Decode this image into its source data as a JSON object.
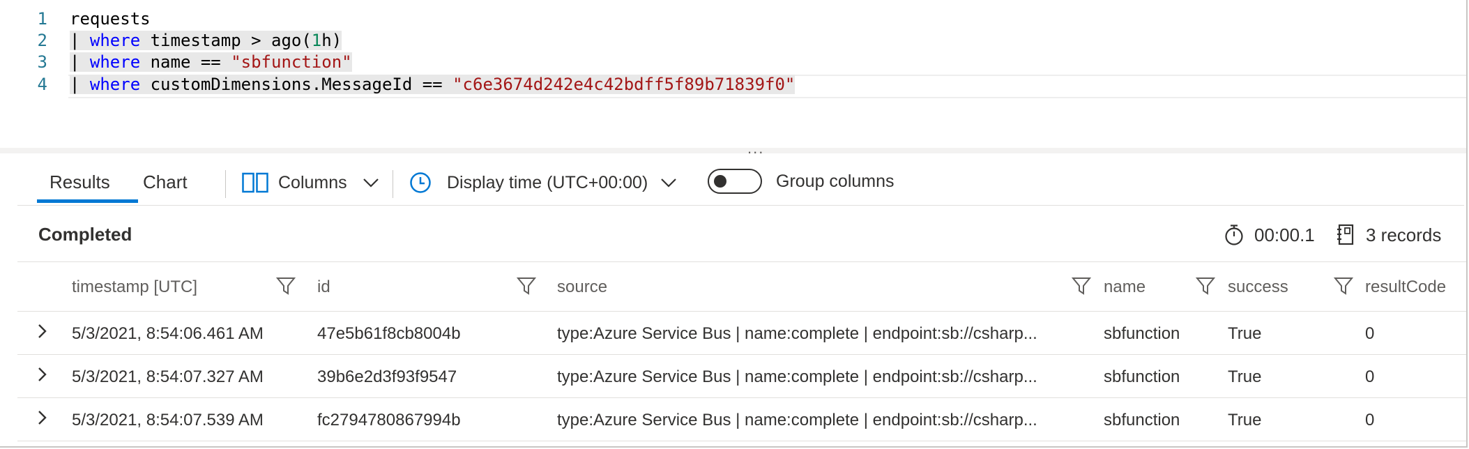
{
  "editor": {
    "lines": [
      {
        "num": "1",
        "parts": [
          {
            "t": "requests",
            "c": ""
          }
        ]
      },
      {
        "num": "2",
        "parts": [
          {
            "t": "| ",
            "c": ""
          },
          {
            "t": "where",
            "c": "kw"
          },
          {
            "t": " timestamp > ago(",
            "c": ""
          },
          {
            "t": "1",
            "c": "num"
          },
          {
            "t": "h)",
            "c": ""
          }
        ]
      },
      {
        "num": "3",
        "parts": [
          {
            "t": "| ",
            "c": ""
          },
          {
            "t": "where",
            "c": "kw"
          },
          {
            "t": " name == ",
            "c": ""
          },
          {
            "t": "\"sbfunction\"",
            "c": "str"
          }
        ]
      },
      {
        "num": "4",
        "parts": [
          {
            "t": "| ",
            "c": ""
          },
          {
            "t": "where",
            "c": "kw"
          },
          {
            "t": " customDimensions.MessageId == ",
            "c": ""
          },
          {
            "t": "\"c6e3674d242e4c42bdff5f89b71839f0\"",
            "c": "str"
          }
        ]
      }
    ],
    "splitter_handle": "..."
  },
  "toolbar": {
    "tabs": [
      "Results",
      "Chart"
    ],
    "active_tab": "Results",
    "columns_label": "Columns",
    "display_time_label": "Display time (UTC+00:00)",
    "group_columns_label": "Group columns",
    "group_columns_on": false
  },
  "status": {
    "state": "Completed",
    "duration": "00:00.1",
    "records": "3 records"
  },
  "table": {
    "columns": [
      "timestamp [UTC]",
      "id",
      "source",
      "name",
      "success",
      "resultCode"
    ],
    "rows": [
      [
        "5/3/2021, 8:54:06.461 AM",
        "47e5b61f8cb8004b",
        "type:Azure Service Bus | name:complete | endpoint:sb://csharp...",
        "sbfunction",
        "True",
        "0"
      ],
      [
        "5/3/2021, 8:54:07.327 AM",
        "39b6e2d3f93f9547",
        "type:Azure Service Bus | name:complete | endpoint:sb://csharp...",
        "sbfunction",
        "True",
        "0"
      ],
      [
        "5/3/2021, 8:54:07.539 AM",
        "fc2794780867994b",
        "type:Azure Service Bus | name:complete | endpoint:sb://csharp...",
        "sbfunction",
        "True",
        "0"
      ]
    ]
  },
  "colors": {
    "accent": "#0078d4",
    "keyword": "#0000ff",
    "string": "#a31515",
    "number": "#098658",
    "line_number": "#237893"
  },
  "icons": [
    "columns-icon",
    "chevron-down-icon",
    "clock-icon",
    "stopwatch-icon",
    "records-icon",
    "filter-icon",
    "chevron-right-icon"
  ]
}
